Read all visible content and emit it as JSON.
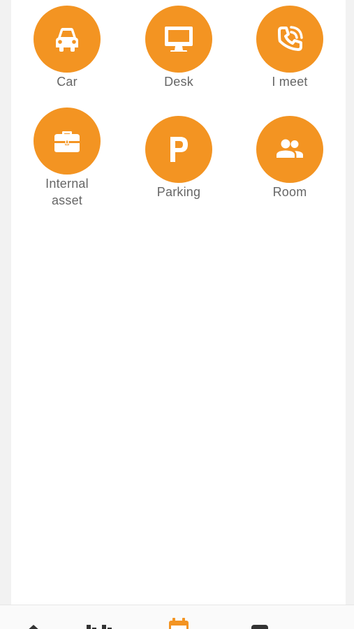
{
  "accent_color": "#f39422",
  "tiles": [
    {
      "label": "Car",
      "icon": "car-icon"
    },
    {
      "label": "Desk",
      "icon": "desktop-monitor-icon"
    },
    {
      "label": "I meet",
      "icon": "phone-call-icon"
    },
    {
      "label": "Internal\nasset",
      "icon": "briefcase-icon"
    },
    {
      "label": "Parking",
      "icon": "parking-icon"
    },
    {
      "label": "Room",
      "icon": "people-group-icon"
    }
  ],
  "bottom_nav": {
    "items": [
      {
        "icon": "home-icon"
      },
      {
        "icon": "menu-icon"
      },
      {
        "icon": "calendar-icon",
        "active": true
      },
      {
        "icon": "chat-icon"
      }
    ]
  }
}
